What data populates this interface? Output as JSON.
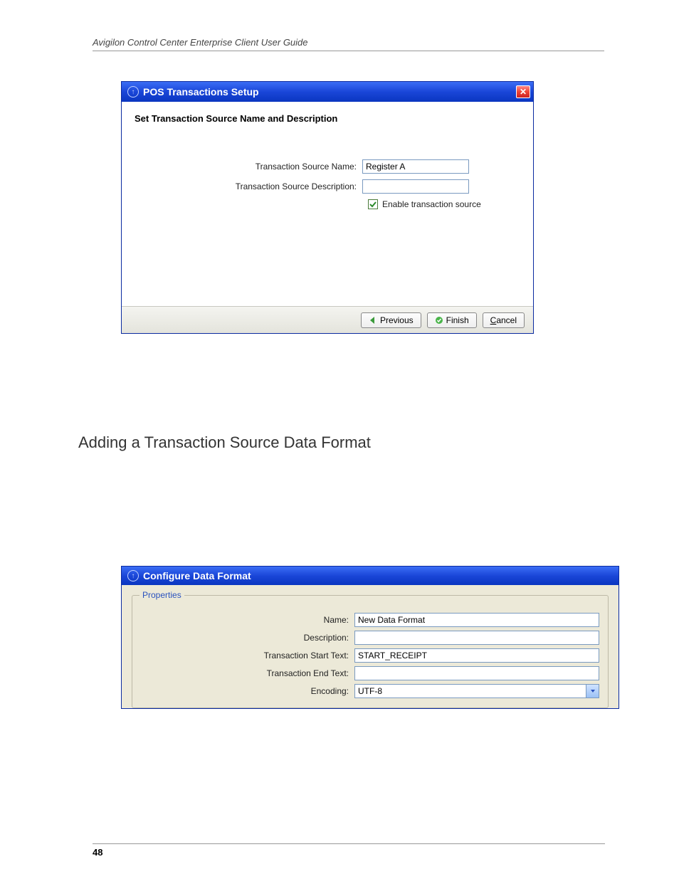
{
  "doc_header": "Avigilon Control Center Enterprise Client User Guide",
  "page_number": "48",
  "dialog1": {
    "title": "POS Transactions Setup",
    "subheader": "Set Transaction Source Name and Description",
    "labels": {
      "name": "Transaction Source Name:",
      "desc": "Transaction Source Description:"
    },
    "values": {
      "name": "Register A",
      "desc": ""
    },
    "checkbox_label": "Enable transaction source",
    "checkbox_checked": true,
    "buttons": {
      "previous": "Previous",
      "finish": "Finish",
      "cancel_prefix": "C",
      "cancel_rest": "ancel"
    }
  },
  "section_heading": "Adding a Transaction Source Data Format",
  "dialog2": {
    "title": "Configure Data Format",
    "fieldset_legend": "Properties",
    "rows": {
      "name_label": "Name:",
      "name_value": "New Data Format",
      "desc_label": "Description:",
      "desc_value": "",
      "start_label": "Transaction Start Text:",
      "start_value": "START_RECEIPT",
      "end_label": "Transaction End Text:",
      "end_value": "",
      "encoding_label": "Encoding:",
      "encoding_value": "UTF-8"
    }
  }
}
